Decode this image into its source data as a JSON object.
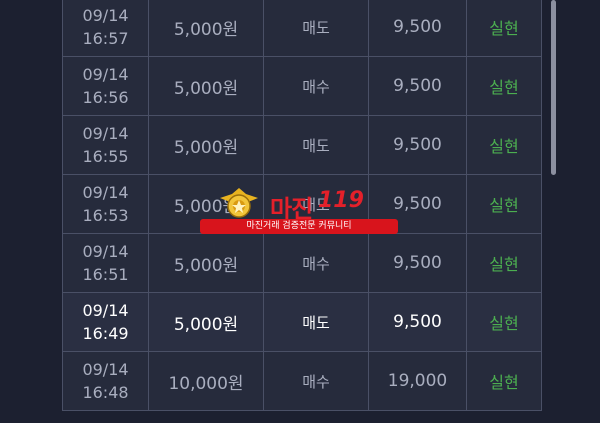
{
  "rows": [
    {
      "date": "09/14",
      "time": "16:57",
      "amount": "5,000원",
      "type": "매도",
      "price": "9,500",
      "status": "실현",
      "highlight": false
    },
    {
      "date": "09/14",
      "time": "16:56",
      "amount": "5,000원",
      "type": "매수",
      "price": "9,500",
      "status": "실현",
      "highlight": false
    },
    {
      "date": "09/14",
      "time": "16:55",
      "amount": "5,000원",
      "type": "매도",
      "price": "9,500",
      "status": "실현",
      "highlight": false
    },
    {
      "date": "09/14",
      "time": "16:53",
      "amount": "5,000원",
      "type": "매도",
      "price": "9,500",
      "status": "실현",
      "highlight": false
    },
    {
      "date": "09/14",
      "time": "16:51",
      "amount": "5,000원",
      "type": "매수",
      "price": "9,500",
      "status": "실현",
      "highlight": false
    },
    {
      "date": "09/14",
      "time": "16:49",
      "amount": "5,000원",
      "type": "매도",
      "price": "9,500",
      "status": "실현",
      "highlight": true
    },
    {
      "date": "09/14",
      "time": "16:48",
      "amount": "10,000원",
      "type": "매수",
      "price": "19,000",
      "status": "실현",
      "highlight": false
    }
  ],
  "watermark": {
    "title": "마진",
    "number": "119",
    "tagline": "마진거래 검증전문 커뮤니티"
  },
  "colors": {
    "background": "#1c2030",
    "row": "#262b3c",
    "border": "#4a5066",
    "text": "#a9aebf",
    "status": "#4caf50",
    "brand": "#e4202a"
  }
}
